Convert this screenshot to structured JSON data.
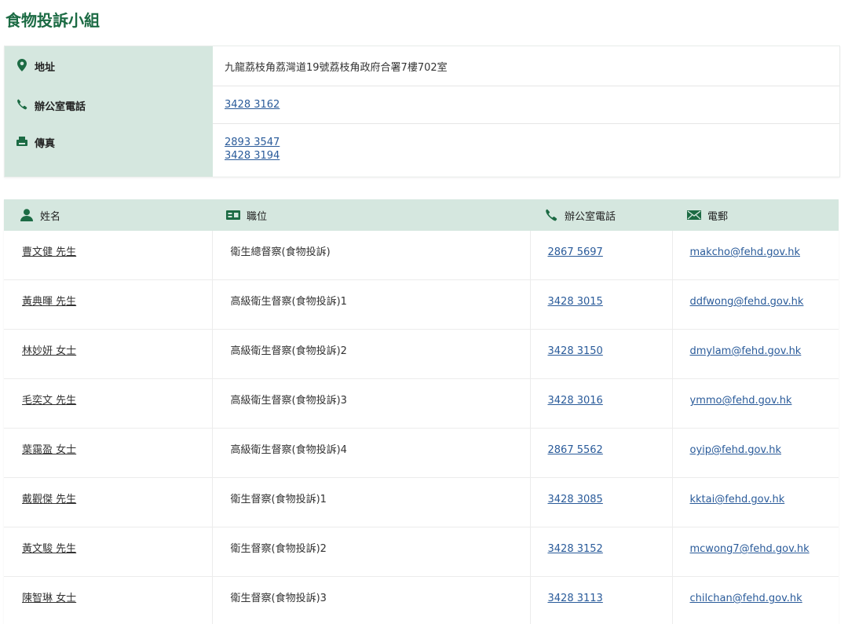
{
  "page": {
    "title": "食物投訴小組"
  },
  "info": {
    "address": {
      "icon": "map-pin-icon",
      "label": "地址",
      "value": "九龍荔枝角荔灣道19號荔枝角政府合署7樓702室"
    },
    "office_phone": {
      "icon": "phone-icon",
      "label": "辦公室電話",
      "value": "3428 3162"
    },
    "fax": {
      "icon": "fax-icon",
      "label": "傳真",
      "values": [
        "2893 3547",
        "3428 3194"
      ]
    }
  },
  "table": {
    "headers": {
      "name": "姓名",
      "position": "職位",
      "phone": "辦公室電話",
      "email": "電郵"
    },
    "rows": [
      {
        "name": "曹文健 先生",
        "position": "衛生總督察(食物投訴)",
        "phone": "2867 5697",
        "email": "makcho@fehd.gov.hk"
      },
      {
        "name": "黃典暉 先生",
        "position": "高級衛生督察(食物投訴)1",
        "phone": "3428 3015",
        "email": "ddfwong@fehd.gov.hk"
      },
      {
        "name": "林妙妍 女士",
        "position": "高級衛生督察(食物投訴)2",
        "phone": "3428 3150",
        "email": "dmylam@fehd.gov.hk"
      },
      {
        "name": "毛奕文 先生",
        "position": "高級衛生督察(食物投訴)3",
        "phone": "3428 3016",
        "email": "ymmo@fehd.gov.hk"
      },
      {
        "name": "葉靄盈 女士",
        "position": "高級衛生督察(食物投訴)4",
        "phone": "2867 5562",
        "email": "oyip@fehd.gov.hk"
      },
      {
        "name": "戴觀傑 先生",
        "position": "衛生督察(食物投訴)1",
        "phone": "3428 3085",
        "email": "kktai@fehd.gov.hk"
      },
      {
        "name": "黃文駿 先生",
        "position": "衛生督察(食物投訴)2",
        "phone": "3428 3152",
        "email": "mcwong7@fehd.gov.hk"
      },
      {
        "name": "陳智琳 女士",
        "position": "衛生督察(食物投訴)3",
        "phone": "3428 3113",
        "email": "chilchan@fehd.gov.hk"
      }
    ]
  },
  "colors": {
    "accent": "#1c6b44",
    "label_bg": "#d5e7df",
    "link": "#2a5b9a"
  }
}
